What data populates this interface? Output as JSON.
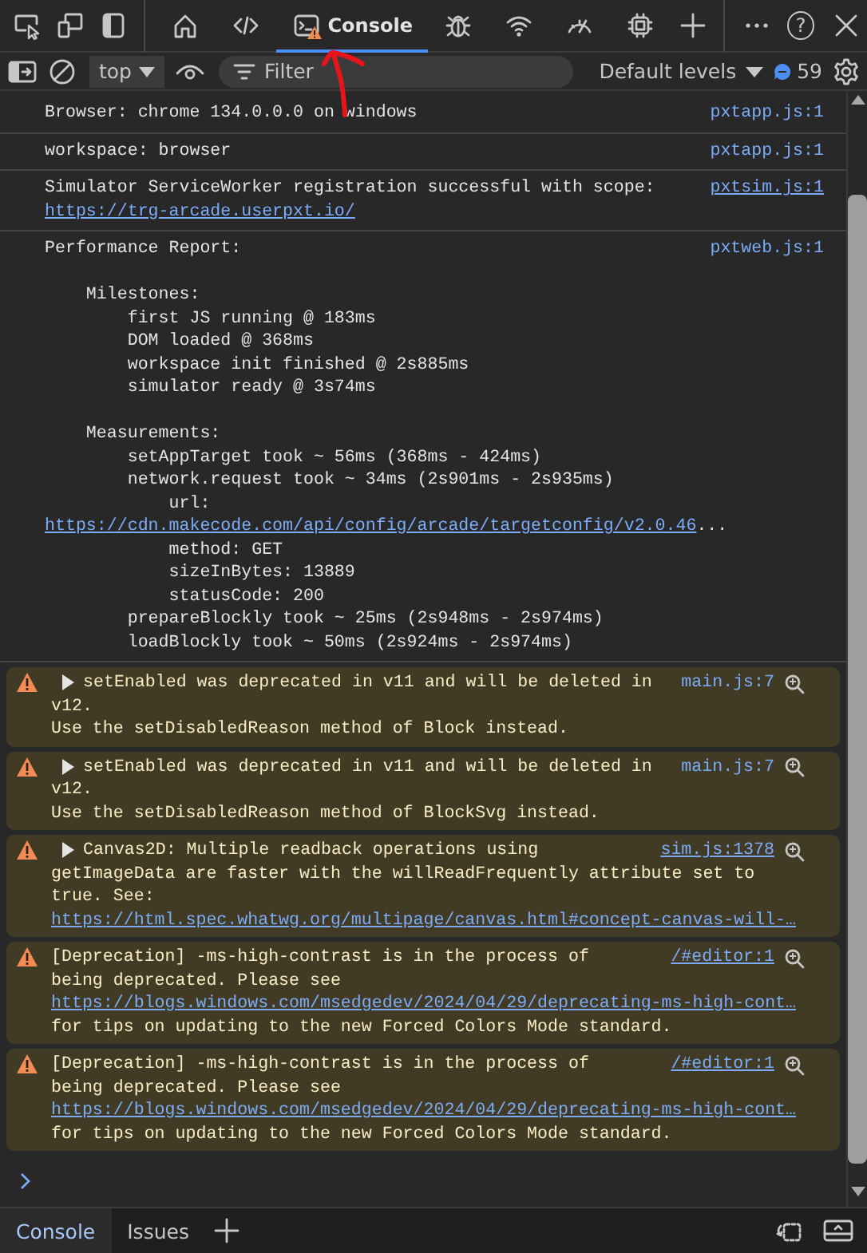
{
  "toolbar": {
    "tabs": [
      {
        "kind": "welcome",
        "selected": false
      },
      {
        "kind": "elements",
        "selected": false
      },
      {
        "kind": "console",
        "label": "Console",
        "selected": true,
        "warning_badge": true
      },
      {
        "kind": "sources",
        "selected": false
      },
      {
        "kind": "network",
        "selected": false
      },
      {
        "kind": "performance",
        "selected": false
      },
      {
        "kind": "memory",
        "selected": false
      }
    ],
    "help_label": "?"
  },
  "filter_bar": {
    "context": "top",
    "placeholder": "Filter",
    "levels": "Default levels",
    "message_count": "59"
  },
  "messages": [
    {
      "kind": "log",
      "text": "Browser: chrome 134.0.0.0 on windows",
      "source": "pxtapp.js:1",
      "source_underlined": false
    },
    {
      "kind": "log",
      "text": "workspace: browser",
      "source": "pxtapp.js:1",
      "source_underlined": false
    },
    {
      "kind": "log",
      "text": "Simulator ServiceWorker registration successful with scope:",
      "parts": [
        {
          "text": "https://trg-arcade.userpxt.io/",
          "link": true
        }
      ],
      "source": "pxtsim.js:1",
      "source_underlined": true
    },
    {
      "kind": "log",
      "text": "Performance Report:",
      "parts": [
        {
          "text": "\n    Milestones:\n        first JS running @ 183ms\n        DOM loaded @ 368ms\n        workspace init finished @ 2s885ms\n        simulator ready @ 3s74ms\n\n    Measurements:\n        setAppTarget took ~ 56ms (368ms - 424ms)\n        network.request took ~ 34ms (2s901ms - 2s935ms)\n            url:\n"
        },
        {
          "text": "https://cdn.makecode.com/api/config/arcade/targetconfig/v2.0.46",
          "link": true
        },
        {
          "text": "...\n            method: GET\n            sizeInBytes: 13889\n            statusCode: 200\n        prepareBlockly took ~ 25ms (2s948ms - 2s974ms)\n        loadBlockly took ~ 50ms (2s924ms - 2s974ms)"
        }
      ],
      "source": "pxtweb.js:1",
      "source_underlined": false
    },
    {
      "kind": "warning",
      "expanded": false,
      "text": "setEnabled was deprecated in v11 and will be deleted in",
      "parts": [
        {
          "text": "v12.\nUse the setDisabledReason method of Block instead."
        }
      ],
      "source": "main.js:7",
      "source_underlined": false
    },
    {
      "kind": "warning",
      "expanded": false,
      "text": "setEnabled was deprecated in v11 and will be deleted in",
      "parts": [
        {
          "text": "v12.\nUse the setDisabledReason method of BlockSvg instead."
        }
      ],
      "source": "main.js:7",
      "source_underlined": false
    },
    {
      "kind": "warning",
      "expanded": false,
      "text": "Canvas2D: Multiple readback operations using",
      "parts": [
        {
          "text": "getImageData are faster with the willReadFrequently attribute set to true. See:\n"
        },
        {
          "text": "https://html.spec.whatwg.org/multipage/canvas.html#concept-canvas-will-…",
          "link": true
        }
      ],
      "source": "sim.js:1378",
      "source_underlined": true
    },
    {
      "kind": "warning",
      "text": "[Deprecation] -ms-high-contrast is in the process of",
      "parts": [
        {
          "text": "being deprecated. Please see\n"
        },
        {
          "text": "https://blogs.windows.com/msedgedev/2024/04/29/deprecating-ms-high-cont…",
          "link": true
        },
        {
          "text": "\nfor tips on updating to the new Forced Colors Mode standard."
        }
      ],
      "source": "/#editor:1",
      "source_underlined": true
    },
    {
      "kind": "warning",
      "text": "[Deprecation] -ms-high-contrast is in the process of",
      "parts": [
        {
          "text": "being deprecated. Please see\n"
        },
        {
          "text": "https://blogs.windows.com/msedgedev/2024/04/29/deprecating-ms-high-cont…",
          "link": true
        },
        {
          "text": "\nfor tips on updating to the new Forced Colors Mode standard."
        }
      ],
      "source": "/#editor:1",
      "source_underlined": true
    }
  ],
  "drawer": {
    "tabs": [
      {
        "label": "Console",
        "selected": true
      },
      {
        "label": "Issues",
        "selected": false
      }
    ]
  },
  "annotation": {
    "kind": "arrow"
  }
}
